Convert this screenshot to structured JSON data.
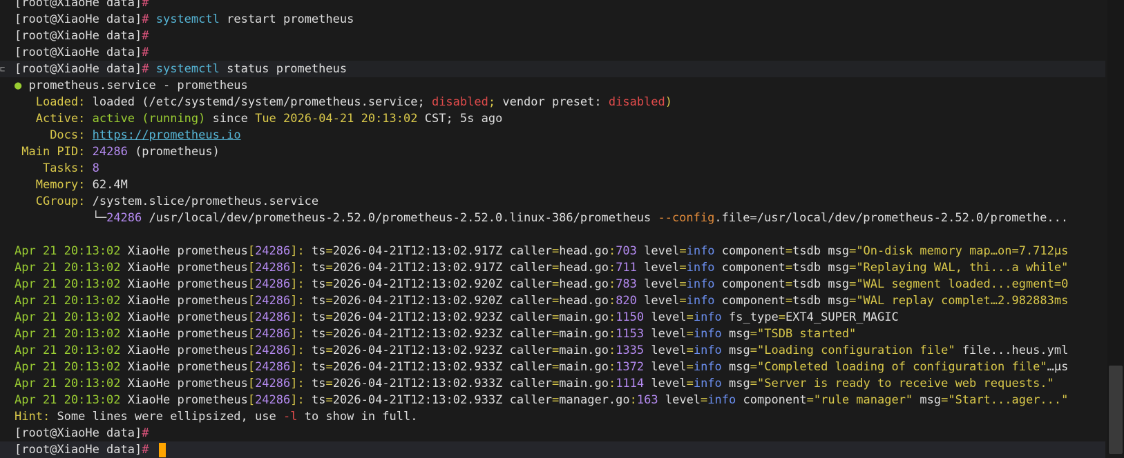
{
  "prompt": "[root@XiaoHe data]",
  "hash": "#",
  "commands": {
    "restart": {
      "cmd": "systemctl",
      "args": "restart prometheus"
    },
    "status": {
      "cmd": "systemctl",
      "args": "status prometheus"
    }
  },
  "status": {
    "bullet": "●",
    "title": "prometheus.service - prometheus",
    "loaded_label": "Loaded:",
    "loaded_value": "loaded",
    "loaded_path": "(/etc/systemd/system/prometheus.service;",
    "disabled": "disabled",
    "vendor_preset": "vendor preset:",
    "active_label": "Active:",
    "active_value": "active (running)",
    "since": "since",
    "since_time": "Tue 2026-04-21 20:13:02",
    "tz_ago": "CST; 5s ago",
    "docs_label": "Docs:",
    "docs_url": "https://prometheus.io",
    "pid_label": "Main PID:",
    "pid": "24286",
    "pid_name": "(prometheus)",
    "tasks_label": "Tasks:",
    "tasks": "8",
    "memory_label": "Memory:",
    "memory": "62.4M",
    "cgroup_label": "CGroup:",
    "cgroup": "/system.slice/prometheus.service",
    "tree_pid": "24286",
    "tree_cmd": "/usr/local/dev/prometheus-2.52.0/prometheus-2.52.0.linux-386/prometheus",
    "tree_flag": "--config",
    "tree_rest": ".file=/usr/local/dev/prometheus-2.52.0/promethe..."
  },
  "log_prefix": {
    "date": "Apr 21 20:13:02",
    "host": "XiaoHe",
    "proc": "prometheus",
    "pid": "24286"
  },
  "logs": [
    {
      "ts": "2026-04-21T12:13:02.917Z",
      "caller": "head.go",
      "line": "703",
      "level": "info",
      "rest": "component=tsdb msg=\"On-disk memory map…on=7.712µs"
    },
    {
      "ts": "2026-04-21T12:13:02.917Z",
      "caller": "head.go",
      "line": "711",
      "level": "info",
      "rest": "component=tsdb msg=\"Replaying WAL, thi...a while\""
    },
    {
      "ts": "2026-04-21T12:13:02.920Z",
      "caller": "head.go",
      "line": "783",
      "level": "info",
      "rest": "component=tsdb msg=\"WAL segment loaded...egment=0"
    },
    {
      "ts": "2026-04-21T12:13:02.920Z",
      "caller": "head.go",
      "line": "820",
      "level": "info",
      "rest": "component=tsdb msg=\"WAL replay complet…2.982883ms"
    },
    {
      "ts": "2026-04-21T12:13:02.923Z",
      "caller": "main.go",
      "line": "1150",
      "level": "info",
      "rest": "fs_type=EXT4_SUPER_MAGIC"
    },
    {
      "ts": "2026-04-21T12:13:02.923Z",
      "caller": "main.go",
      "line": "1153",
      "level": "info",
      "rest": "msg=\"TSDB started\""
    },
    {
      "ts": "2026-04-21T12:13:02.923Z",
      "caller": "main.go",
      "line": "1335",
      "level": "info",
      "rest": "msg=\"Loading configuration file\" file...heus.yml"
    },
    {
      "ts": "2026-04-21T12:13:02.933Z",
      "caller": "main.go",
      "line": "1372",
      "level": "info",
      "rest": "msg=\"Completed loading of configuration file\"…µs"
    },
    {
      "ts": "2026-04-21T12:13:02.933Z",
      "caller": "main.go",
      "line": "1114",
      "level": "info",
      "rest": "msg=\"Server is ready to receive web requests.\""
    },
    {
      "ts": "2026-04-21T12:13:02.933Z",
      "caller": "manager.go",
      "line": "163",
      "level": "info",
      "rest": "component=\"rule manager\" msg=\"Start...ager...\""
    }
  ],
  "hint": {
    "label": "Hint:",
    "text1": "Some lines were ellipsized, use",
    "flag": "-l",
    "text2": "to show in full."
  },
  "colors": {
    "background": "#1b1b1b",
    "cursor": "#ffa500"
  }
}
